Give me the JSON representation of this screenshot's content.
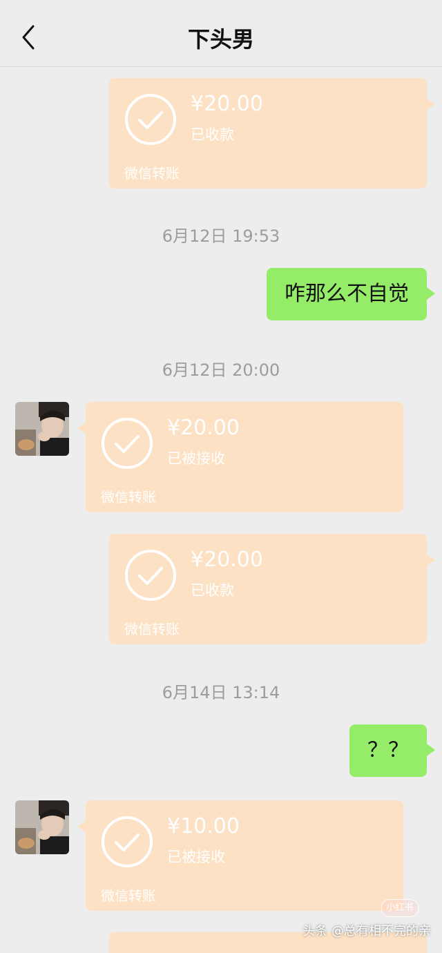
{
  "header": {
    "title": "下头男"
  },
  "messages": [
    {
      "kind": "transfer",
      "amount": "¥20.00",
      "status": "已收款",
      "label": "微信转账"
    },
    {
      "kind": "timestamp",
      "text": "6月12日 19:53"
    },
    {
      "kind": "text",
      "text": "咋那么不自觉"
    },
    {
      "kind": "timestamp",
      "text": "6月12日 20:00"
    },
    {
      "kind": "transfer",
      "amount": "¥20.00",
      "status": "已被接收",
      "label": "微信转账"
    },
    {
      "kind": "transfer",
      "amount": "¥20.00",
      "status": "已收款",
      "label": "微信转账"
    },
    {
      "kind": "timestamp",
      "text": "6月14日 13:14"
    },
    {
      "kind": "text",
      "text": "？？"
    },
    {
      "kind": "transfer",
      "amount": "¥10.00",
      "status": "已被接收",
      "label": "微信转账"
    }
  ],
  "watermark": {
    "text": "头条 @总有相不完的亲",
    "badge": "小红书"
  },
  "colors": {
    "background": "#ededed",
    "transfer_bubble": "#fde1c5",
    "sent_bubble": "#95ec69",
    "timestamp_text": "#9c9c9c"
  },
  "icons": [
    "back-chevron-icon",
    "check-circle-icon",
    "contact-avatar"
  ]
}
